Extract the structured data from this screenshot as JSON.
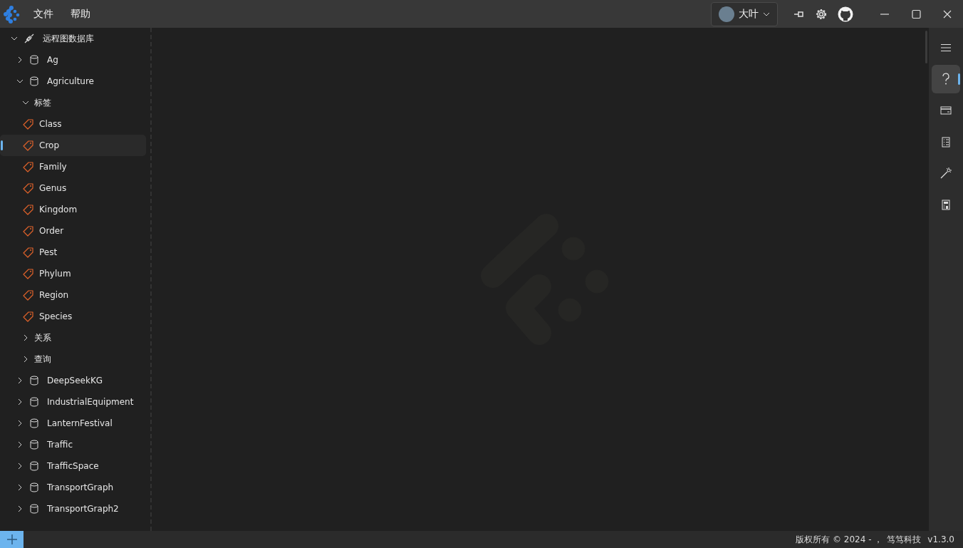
{
  "menu": [
    {
      "label": "文件"
    },
    {
      "label": "帮助"
    }
  ],
  "user": {
    "name": "大叶"
  },
  "tree": [
    {
      "kind": "root",
      "label": "远程图数据库",
      "expanded": true,
      "selected": false,
      "children": [
        {
          "kind": "database",
          "label": "Ag",
          "expanded": false,
          "selected": false
        },
        {
          "kind": "database",
          "label": "Agriculture",
          "expanded": true,
          "selected": false,
          "children": [
            {
              "kind": "group",
              "label": "标签",
              "expanded": true,
              "selected": false,
              "children": [
                {
                  "kind": "tag",
                  "label": "Class",
                  "selected": false
                },
                {
                  "kind": "tag",
                  "label": "Crop",
                  "selected": true
                },
                {
                  "kind": "tag",
                  "label": "Family",
                  "selected": false
                },
                {
                  "kind": "tag",
                  "label": "Genus",
                  "selected": false
                },
                {
                  "kind": "tag",
                  "label": "Kingdom",
                  "selected": false
                },
                {
                  "kind": "tag",
                  "label": "Order",
                  "selected": false
                },
                {
                  "kind": "tag",
                  "label": "Pest",
                  "selected": false
                },
                {
                  "kind": "tag",
                  "label": "Phylum",
                  "selected": false
                },
                {
                  "kind": "tag",
                  "label": "Region",
                  "selected": false
                },
                {
                  "kind": "tag",
                  "label": "Species",
                  "selected": false
                }
              ]
            },
            {
              "kind": "group",
              "label": "关系",
              "expanded": false,
              "selected": false
            },
            {
              "kind": "group",
              "label": "查询",
              "expanded": false,
              "selected": false
            }
          ]
        },
        {
          "kind": "database",
          "label": "DeepSeekKG",
          "expanded": false,
          "selected": false
        },
        {
          "kind": "database",
          "label": "IndustrialEquipment",
          "expanded": false,
          "selected": false
        },
        {
          "kind": "database",
          "label": "LanternFestival",
          "expanded": false,
          "selected": false
        },
        {
          "kind": "database",
          "label": "Traffic",
          "expanded": false,
          "selected": false
        },
        {
          "kind": "database",
          "label": "TrafficSpace",
          "expanded": false,
          "selected": false
        },
        {
          "kind": "database",
          "label": "TransportGraph",
          "expanded": false,
          "selected": false
        },
        {
          "kind": "database",
          "label": "TransportGraph2",
          "expanded": false,
          "selected": false
        }
      ]
    }
  ],
  "rail": [
    {
      "kind": "help",
      "selected": true
    },
    {
      "kind": "card",
      "selected": false
    },
    {
      "kind": "list",
      "selected": false
    },
    {
      "kind": "wand",
      "selected": false
    },
    {
      "kind": "calculator",
      "selected": false
    }
  ],
  "status_bar": {
    "copyright": "版权所有 © 2024 - ，",
    "company": "笃笃科技",
    "version": "v1.3.0"
  }
}
